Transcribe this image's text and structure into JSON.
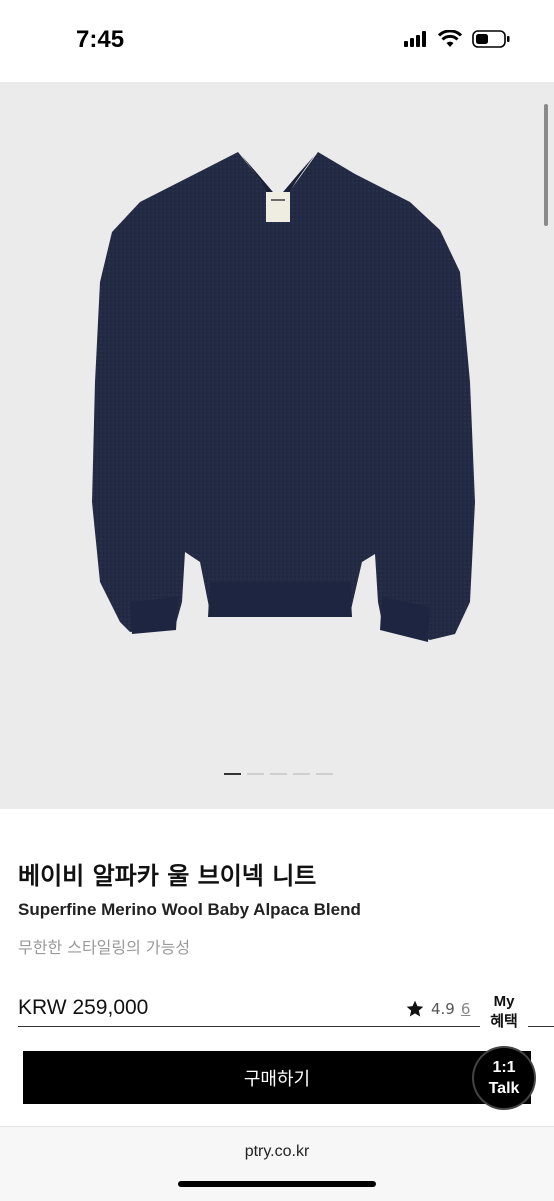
{
  "status_bar": {
    "time": "7:45",
    "icons": [
      "signal-icon",
      "wifi-icon",
      "battery-icon"
    ]
  },
  "gallery": {
    "image": "navy-v-neck-sweater",
    "slide_count": 5,
    "active_slide": 1
  },
  "product": {
    "title_ko": "베이비 알파카 울 브이넥 니트",
    "title_en": "Superfine Merino Wool Baby Alpaca Blend",
    "tagline": "무한한 스타일링의 가능성",
    "price": "KRW 259,000",
    "rating": "4.9",
    "review_count": "6"
  },
  "floating": {
    "my_benefit_line1": "My",
    "my_benefit_line2": "혜택",
    "talk_line1": "1:1",
    "talk_line2": "Talk"
  },
  "buy_button": {
    "label": "구매하기"
  },
  "browser": {
    "url": "ptry.co.kr"
  },
  "colors": {
    "sweater": "#222a45",
    "background": "#ebebeb",
    "button": "#000000"
  }
}
